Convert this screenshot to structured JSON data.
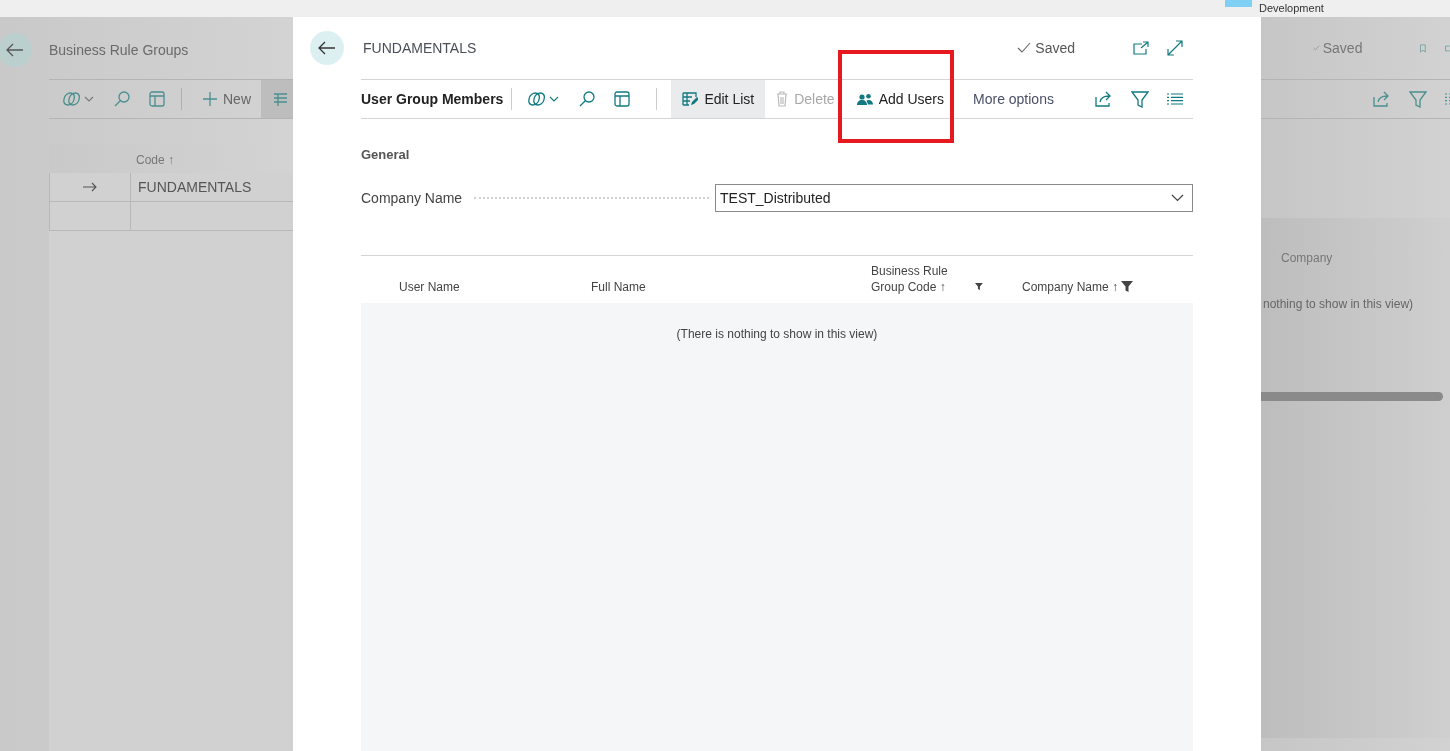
{
  "top_bar": {
    "environment": "Development"
  },
  "background_page": {
    "title": "Business Rule Groups",
    "new_label": "New",
    "status": "Saved",
    "column_header": "Code ↑",
    "rows": [
      {
        "code": "FUNDAMENTALS",
        "current": true
      }
    ],
    "right_column_header": "Company",
    "right_empty_text": "nothing to show in this view)"
  },
  "dialog": {
    "title": "FUNDAMENTALS",
    "status": "Saved",
    "toolbar": {
      "title": "User Group Members",
      "actions": [
        {
          "label": "Edit List",
          "kind": "edit",
          "selected": true,
          "disabled": false
        },
        {
          "label": "Delete",
          "kind": "delete",
          "selected": false,
          "disabled": true
        },
        {
          "label": "Add Users",
          "kind": "users",
          "selected": false,
          "disabled": false
        }
      ],
      "more": "More options"
    },
    "section": "General",
    "fields": [
      {
        "label": "Company Name",
        "value": "TEST_Distributed"
      }
    ],
    "table": {
      "columns": [
        {
          "label": "User Name",
          "filtered": false
        },
        {
          "label": "Full Name",
          "filtered": false
        },
        {
          "label": "Business Rule Group Code ↑",
          "filtered": true
        },
        {
          "label": "Company Name ↑",
          "filtered": true
        }
      ],
      "empty_text": "(There is nothing to show in this view)"
    }
  },
  "annotation": {
    "kind": "frame"
  }
}
